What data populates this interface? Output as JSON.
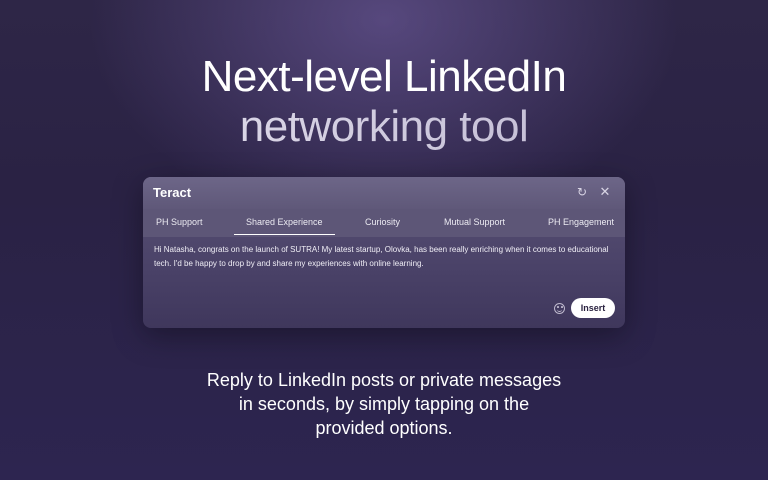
{
  "hero": {
    "title_line1": "Next-level LinkedIn",
    "title_line2": "networking tool"
  },
  "panel": {
    "app_title": "Teract",
    "icons": {
      "refresh": "refresh-icon",
      "close": "close-icon"
    },
    "tabs": [
      {
        "label": "PH Support"
      },
      {
        "label": "Shared Experience",
        "active": true
      },
      {
        "label": "Curiosity"
      },
      {
        "label": "Mutual Support"
      },
      {
        "label": "PH Engagement"
      }
    ],
    "message": "Hi Natasha, congrats on the launch of SUTRA! My latest startup, Olovka, has been really enriching when it comes to educational tech. I'd be happy to drop by and share my experiences with online learning.",
    "insert_label": "Insert"
  },
  "subtitle": {
    "line1": "Reply to LinkedIn posts or private messages",
    "line2": "in seconds, by simply tapping on the",
    "line3": "provided options."
  }
}
